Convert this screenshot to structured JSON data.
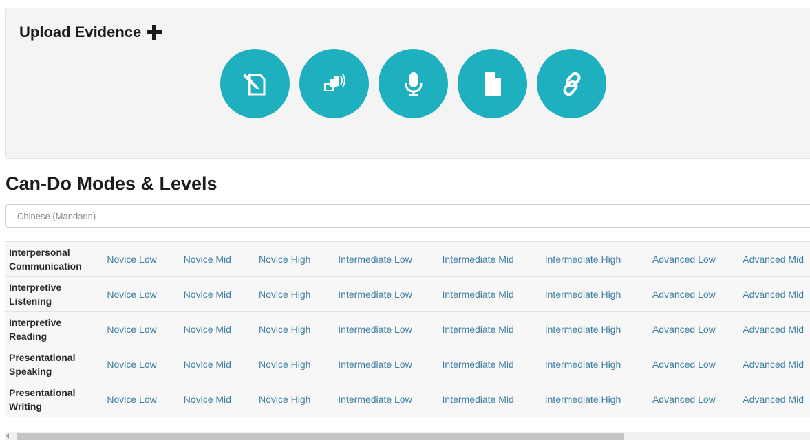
{
  "upload": {
    "title": "Upload Evidence",
    "buttons": [
      {
        "icon": "edit-document-icon"
      },
      {
        "icon": "media-icon"
      },
      {
        "icon": "microphone-icon"
      },
      {
        "icon": "file-icon"
      },
      {
        "icon": "link-icon"
      }
    ]
  },
  "cando": {
    "title": "Can-Do Modes & Levels",
    "language": "Chinese (Mandarin)",
    "levels": [
      "Novice Low",
      "Novice Mid",
      "Novice High",
      "Intermediate Low",
      "Intermediate Mid",
      "Intermediate High",
      "Advanced Low",
      "Advanced Mid"
    ],
    "rows": [
      {
        "mode_line1": "Interpersonal",
        "mode_line2": "Communication"
      },
      {
        "mode_line1": "Interpretive",
        "mode_line2": "Listening"
      },
      {
        "mode_line1": "Interpretive",
        "mode_line2": "Reading"
      },
      {
        "mode_line1": "Presentational",
        "mode_line2": "Speaking"
      },
      {
        "mode_line1": "Presentational",
        "mode_line2": "Writing"
      }
    ]
  },
  "colors": {
    "accent": "#1fb0bf",
    "link": "#3d7fa3",
    "panel_bg": "#f4f4f4"
  }
}
